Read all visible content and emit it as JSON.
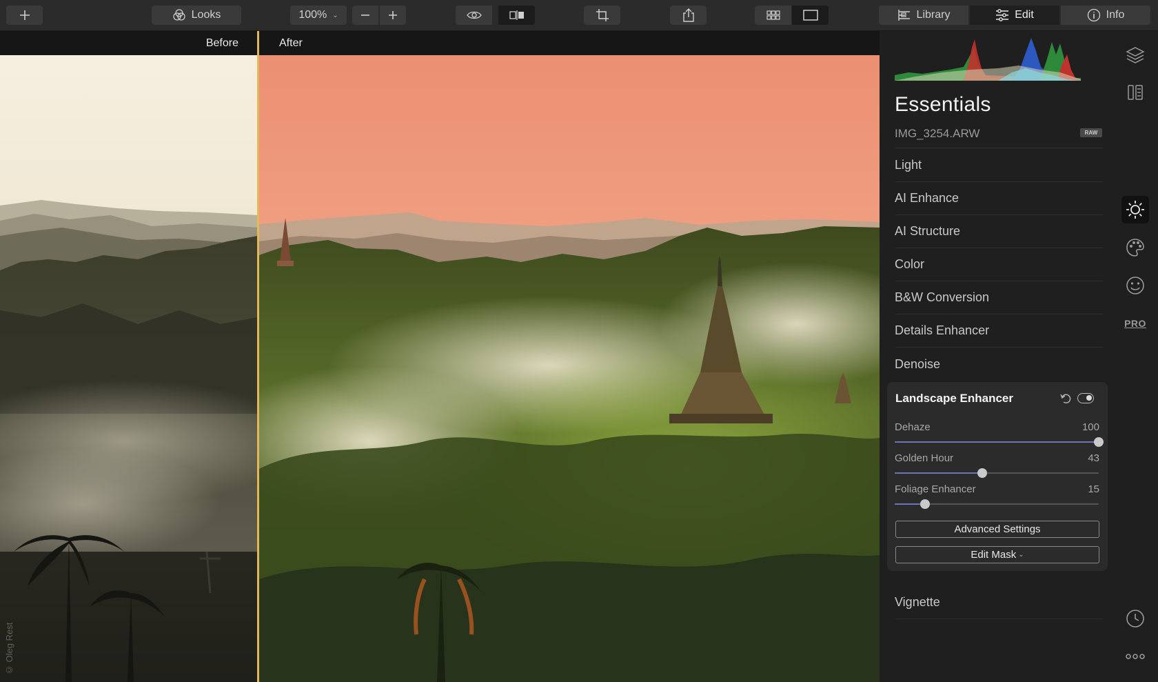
{
  "toolbar": {
    "looks_label": "Looks",
    "zoom_value": "100%",
    "library_label": "Library",
    "edit_label": "Edit",
    "info_label": "Info"
  },
  "canvas": {
    "before_label": "Before",
    "after_label": "After",
    "credit": "© Oleg Rest"
  },
  "panel": {
    "title": "Essentials",
    "file_name": "IMG_3254.ARW",
    "file_badge": "RAW",
    "sections_top": [
      "Light",
      "AI Enhance",
      "AI Structure",
      "Color",
      "B&W Conversion",
      "Details Enhancer",
      "Denoise"
    ],
    "card": {
      "title": "Landscape Enhancer",
      "sliders": [
        {
          "label": "Dehaze",
          "value": "100",
          "fraction": 1.0
        },
        {
          "label": "Golden Hour",
          "value": "43",
          "fraction": 0.43
        },
        {
          "label": "Foliage Enhancer",
          "value": "15",
          "fraction": 0.15
        }
      ],
      "advanced_label": "Advanced Settings",
      "mask_label": "Edit Mask"
    },
    "sections_bottom": [
      "Vignette"
    ]
  },
  "rail": {
    "pro_label": "PRO"
  },
  "colors": {
    "split_line": "#e3b75c",
    "slider_fill": "#6d76b9"
  }
}
